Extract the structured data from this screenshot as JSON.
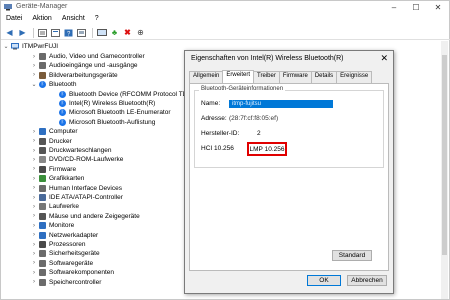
{
  "window": {
    "title": "Geräte-Manager",
    "controls": [
      "–",
      "☐",
      "✕"
    ]
  },
  "menu": [
    "Datei",
    "Aktion",
    "Ansicht",
    "?"
  ],
  "tree": {
    "root": "ITMPwrFUJI",
    "items": [
      {
        "label": "Audio, Video und Gamecontroller",
        "icon": "speaker-icon",
        "color": "#6b6b6b"
      },
      {
        "label": "Audioeingänge und -ausgänge",
        "icon": "speaker-icon",
        "color": "#6b6b6b"
      },
      {
        "label": "Bildverarbeitungsgeräte",
        "icon": "camera-icon",
        "color": "#7a5b3a"
      },
      {
        "label": "Bluetooth",
        "icon": "bluetooth-icon",
        "color": "#1a73e8",
        "expanded": true
      },
      {
        "label": "Bluetooth Device (RFCOMM Protocol TDI)",
        "icon": "bluetooth-icon",
        "color": "#1a73e8",
        "child": true
      },
      {
        "label": "Intel(R) Wireless Bluetooth(R)",
        "icon": "bluetooth-icon",
        "color": "#1a73e8",
        "child": true
      },
      {
        "label": "Microsoft Bluetooth LE-Enumerator",
        "icon": "bluetooth-icon",
        "color": "#1a73e8",
        "child": true
      },
      {
        "label": "Microsoft Bluetooth-Auflistung",
        "icon": "bluetooth-icon",
        "color": "#1a73e8",
        "child": true
      },
      {
        "label": "Computer",
        "icon": "computer-icon",
        "color": "#2e6fc1"
      },
      {
        "label": "Drucker",
        "icon": "printer-icon",
        "color": "#555555"
      },
      {
        "label": "Druckwarteschlangen",
        "icon": "printer-icon",
        "color": "#555555"
      },
      {
        "label": "DVD/CD-ROM-Laufwerke",
        "icon": "disc-icon",
        "color": "#888888"
      },
      {
        "label": "Firmware",
        "icon": "chip-icon",
        "color": "#4a4a4a"
      },
      {
        "label": "Grafikkarten",
        "icon": "display-adapter-icon",
        "color": "#3a8f3a"
      },
      {
        "label": "Human Interface Devices",
        "icon": "hid-icon",
        "color": "#6b6b6b"
      },
      {
        "label": "IDE ATA/ATAPI-Controller",
        "icon": "controller-icon",
        "color": "#4a6a9a"
      },
      {
        "label": "Laufwerke",
        "icon": "drive-icon",
        "color": "#777777"
      },
      {
        "label": "Mäuse und andere Zeigegeräte",
        "icon": "mouse-icon",
        "color": "#555555"
      },
      {
        "label": "Monitore",
        "icon": "monitor-icon",
        "color": "#2e6fc1"
      },
      {
        "label": "Netzwerkadapter",
        "icon": "network-icon",
        "color": "#2e6fc1"
      },
      {
        "label": "Prozessoren",
        "icon": "cpu-icon",
        "color": "#4a4a4a"
      },
      {
        "label": "Sicherheitsgeräte",
        "icon": "security-icon",
        "color": "#6b6b6b"
      },
      {
        "label": "Softwaregeräte",
        "icon": "software-icon",
        "color": "#6b6b6b"
      },
      {
        "label": "Softwarekomponenten",
        "icon": "software-icon",
        "color": "#6b6b6b"
      },
      {
        "label": "Speichercontroller",
        "icon": "storage-icon",
        "color": "#6b6b6b"
      }
    ]
  },
  "dialog": {
    "title": "Eigenschaften von Intel(R) Wireless Bluetooth(R)",
    "close": "✕",
    "tabs": [
      "Allgemein",
      "Erweitert",
      "Treiber",
      "Firmware",
      "Details",
      "Ereignisse"
    ],
    "selected_tab": "Erweitert",
    "group_title": "Bluetooth-Geräteinformationen",
    "name_label": "Name:",
    "name_value": "itmp-fujitsu",
    "address_label": "Adresse:",
    "address_value": "(28:7f:cf:f8:05:ef)",
    "manufacturer_label": "Hersteller-ID:",
    "manufacturer_value": "2",
    "hci": "HCI 10.256",
    "lmp": "LMP 10.256",
    "default_button": "Standard",
    "ok_button": "OK",
    "cancel_button": "Abbrechen"
  }
}
